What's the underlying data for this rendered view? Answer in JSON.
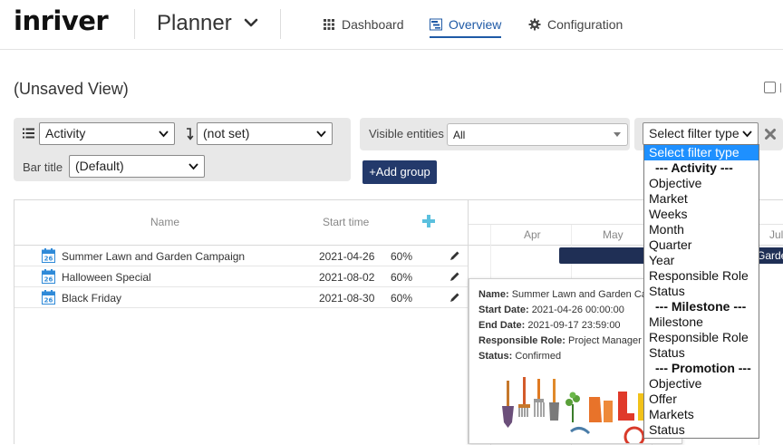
{
  "header": {
    "logo": "inriver",
    "app_title": "Planner",
    "nav": [
      {
        "label": "Dashboard",
        "icon": "grid-icon"
      },
      {
        "label": "Overview",
        "icon": "gantt-icon",
        "active": true
      },
      {
        "label": "Configuration",
        "icon": "gear-icon"
      }
    ]
  },
  "view": {
    "title": "(Unsaved View)"
  },
  "toolbar": {
    "entity_select": "Activity",
    "sort_select": "(not set)",
    "bar_title_label": "Bar title",
    "bar_title_select": "(Default)",
    "visible_entities_label": "Visible entities",
    "visible_entities_value": "All",
    "add_group_label": "+Add group",
    "filter_select": "Select filter type"
  },
  "grid": {
    "columns": [
      "Name",
      "Start time"
    ],
    "rows": [
      {
        "name": "Summer Lawn and Garden Campaign",
        "start": "2021-04-26",
        "progress": "60%"
      },
      {
        "name": "Halloween Special",
        "start": "2021-08-02",
        "progress": "60%"
      },
      {
        "name": "Black Friday",
        "start": "2021-08-30",
        "progress": "60%"
      }
    ]
  },
  "gantt": {
    "months": [
      "Apr",
      "May",
      "Jul"
    ],
    "bar_label": "Garde"
  },
  "tooltip": {
    "lines": [
      {
        "label": "Name:",
        "value": "Summer Lawn and Garden Ca"
      },
      {
        "label": "Start Date:",
        "value": "2021-04-26 00:00:00"
      },
      {
        "label": "End Date:",
        "value": "2021-09-17 23:59:00"
      },
      {
        "label": "Responsible Role:",
        "value": "Project Manager"
      },
      {
        "label": "Status:",
        "value": "Confirmed"
      }
    ]
  },
  "filter_dropdown": {
    "options": [
      {
        "label": "Select filter type",
        "kind": "selected"
      },
      {
        "label": "--- Activity ---",
        "kind": "group"
      },
      {
        "label": "Objective",
        "kind": "option"
      },
      {
        "label": "Market",
        "kind": "option"
      },
      {
        "label": "Weeks",
        "kind": "option"
      },
      {
        "label": "Month",
        "kind": "option"
      },
      {
        "label": "Quarter",
        "kind": "option"
      },
      {
        "label": "Year",
        "kind": "option"
      },
      {
        "label": "Responsible Role",
        "kind": "option"
      },
      {
        "label": "Status",
        "kind": "option"
      },
      {
        "label": "--- Milestone ---",
        "kind": "group"
      },
      {
        "label": "Milestone",
        "kind": "option"
      },
      {
        "label": "Responsible Role",
        "kind": "option"
      },
      {
        "label": "Status",
        "kind": "option"
      },
      {
        "label": "--- Promotion ---",
        "kind": "group"
      },
      {
        "label": "Objective",
        "kind": "option"
      },
      {
        "label": "Offer",
        "kind": "option"
      },
      {
        "label": "Markets",
        "kind": "option"
      },
      {
        "label": "Status",
        "kind": "option"
      }
    ]
  },
  "colors": {
    "accent": "#1f5aa6",
    "primary_button": "#23396b",
    "gantt_bar": "#1f2f55",
    "dropdown_selected": "#1e90ff",
    "add_icon": "#5bc0de"
  }
}
